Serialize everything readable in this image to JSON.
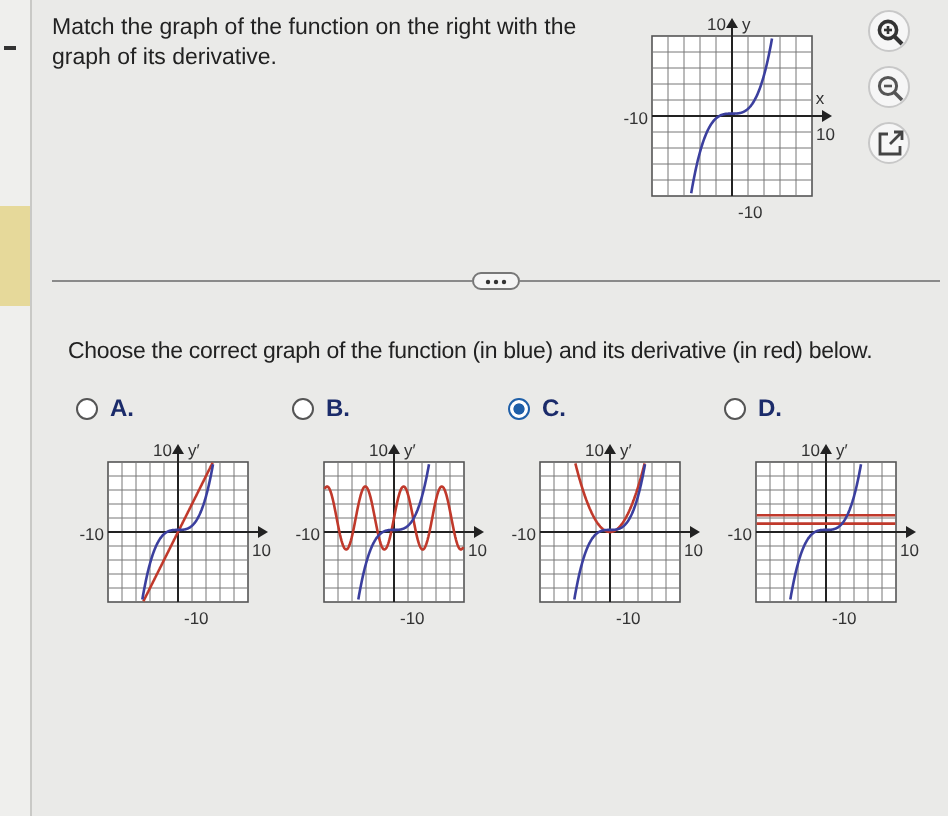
{
  "question": {
    "text": "Match the graph of the function on the right with the graph of its derivative."
  },
  "main_graph": {
    "y_label": "y",
    "x_label": "x",
    "y_max": "10",
    "x_min": "-10",
    "x_max": "10",
    "y_min": "-10"
  },
  "prompt": "Choose the correct graph of the function (in blue) and its derivative (in red) below.",
  "options": [
    {
      "letter": "A.",
      "selected": false,
      "kind": "linear",
      "y_label": "y′",
      "y_max": "10",
      "x_min": "-10",
      "x_max": "10",
      "y_min": "-10"
    },
    {
      "letter": "B.",
      "selected": false,
      "kind": "wave",
      "y_label": "y′",
      "y_max": "10",
      "x_min": "-10",
      "x_max": "10",
      "y_min": "-10"
    },
    {
      "letter": "C.",
      "selected": true,
      "kind": "parabola",
      "y_label": "y′",
      "y_max": "10",
      "x_min": "-10",
      "x_max": "10",
      "y_min": "-10"
    },
    {
      "letter": "D.",
      "selected": false,
      "kind": "constant",
      "y_label": "y′",
      "y_max": "10",
      "x_min": "-10",
      "x_max": "10",
      "y_min": "-10"
    }
  ]
}
